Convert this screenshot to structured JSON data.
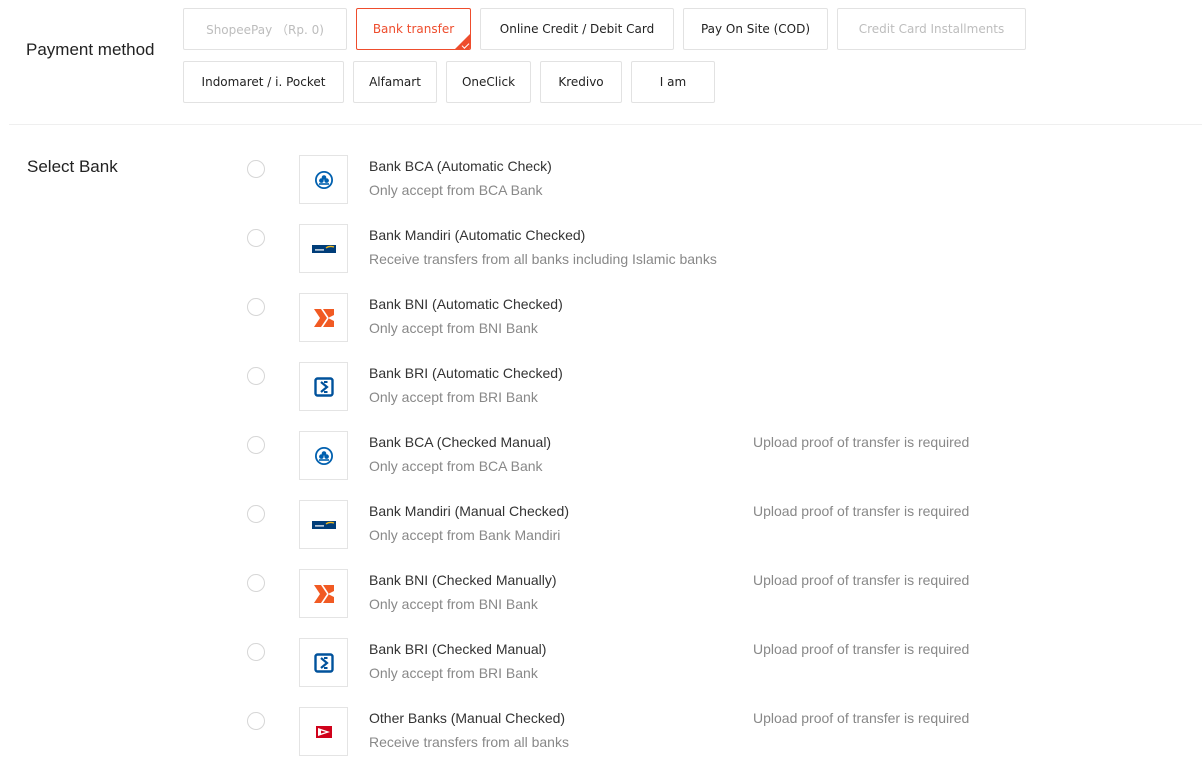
{
  "payment_method": {
    "label": "Payment method",
    "options": [
      {
        "label": "ShopeePay （Rp. 0)",
        "state": "disabled"
      },
      {
        "label": "Bank transfer",
        "state": "selected"
      },
      {
        "label": "Online Credit / Debit Card",
        "state": "normal"
      },
      {
        "label": "Pay On Site (COD)",
        "state": "normal"
      },
      {
        "label": "Credit Card Installments",
        "state": "disabled"
      },
      {
        "label": "Indomaret / i. Pocket",
        "state": "normal"
      },
      {
        "label": "Alfamart",
        "state": "normal"
      },
      {
        "label": "OneClick",
        "state": "normal"
      },
      {
        "label": "Kredivo",
        "state": "normal"
      },
      {
        "label": "I am",
        "state": "normal"
      }
    ]
  },
  "select_bank": {
    "label": "Select Bank",
    "banks": [
      {
        "logo": "bca-logo-icon",
        "name": "Bank BCA (Automatic Check)",
        "desc": "Only accept from BCA Bank",
        "note": ""
      },
      {
        "logo": "mandiri-logo-icon",
        "name": "Bank Mandiri (Automatic Checked)",
        "desc": "Receive transfers from all banks including Islamic banks",
        "note": ""
      },
      {
        "logo": "bni-logo-icon",
        "name": "Bank BNI (Automatic Checked)",
        "desc": "Only accept from BNI Bank",
        "note": ""
      },
      {
        "logo": "bri-logo-icon",
        "name": "Bank BRI (Automatic Checked)",
        "desc": "Only accept from BRI Bank",
        "note": ""
      },
      {
        "logo": "bca-logo-icon",
        "name": "Bank BCA (Checked Manual)",
        "desc": "Only accept from BCA Bank",
        "note": "Upload proof of transfer is required"
      },
      {
        "logo": "mandiri-logo-icon",
        "name": "Bank Mandiri (Manual Checked)",
        "desc": "Only accept from Bank Mandiri",
        "note": "Upload proof of transfer is required"
      },
      {
        "logo": "bni-logo-icon",
        "name": "Bank BNI (Checked Manually)",
        "desc": "Only accept from BNI Bank",
        "note": "Upload proof of transfer is required"
      },
      {
        "logo": "bri-logo-icon",
        "name": "Bank BRI (Checked Manual)",
        "desc": "Only accept from BRI Bank",
        "note": "Upload proof of transfer is required"
      },
      {
        "logo": "other-bank-logo-icon",
        "name": "Other Banks (Manual Checked)",
        "desc": "Receive transfers from all banks",
        "note": "Upload proof of transfer is required"
      }
    ]
  },
  "colors": {
    "accent": "#ee4d2d",
    "bca_blue": "#0060af",
    "mandiri_navy": "#003d79",
    "mandiri_gold": "#f2b719",
    "bni_orange": "#f15a23",
    "bri_navy": "#00529c",
    "other_red": "#d0021b"
  }
}
